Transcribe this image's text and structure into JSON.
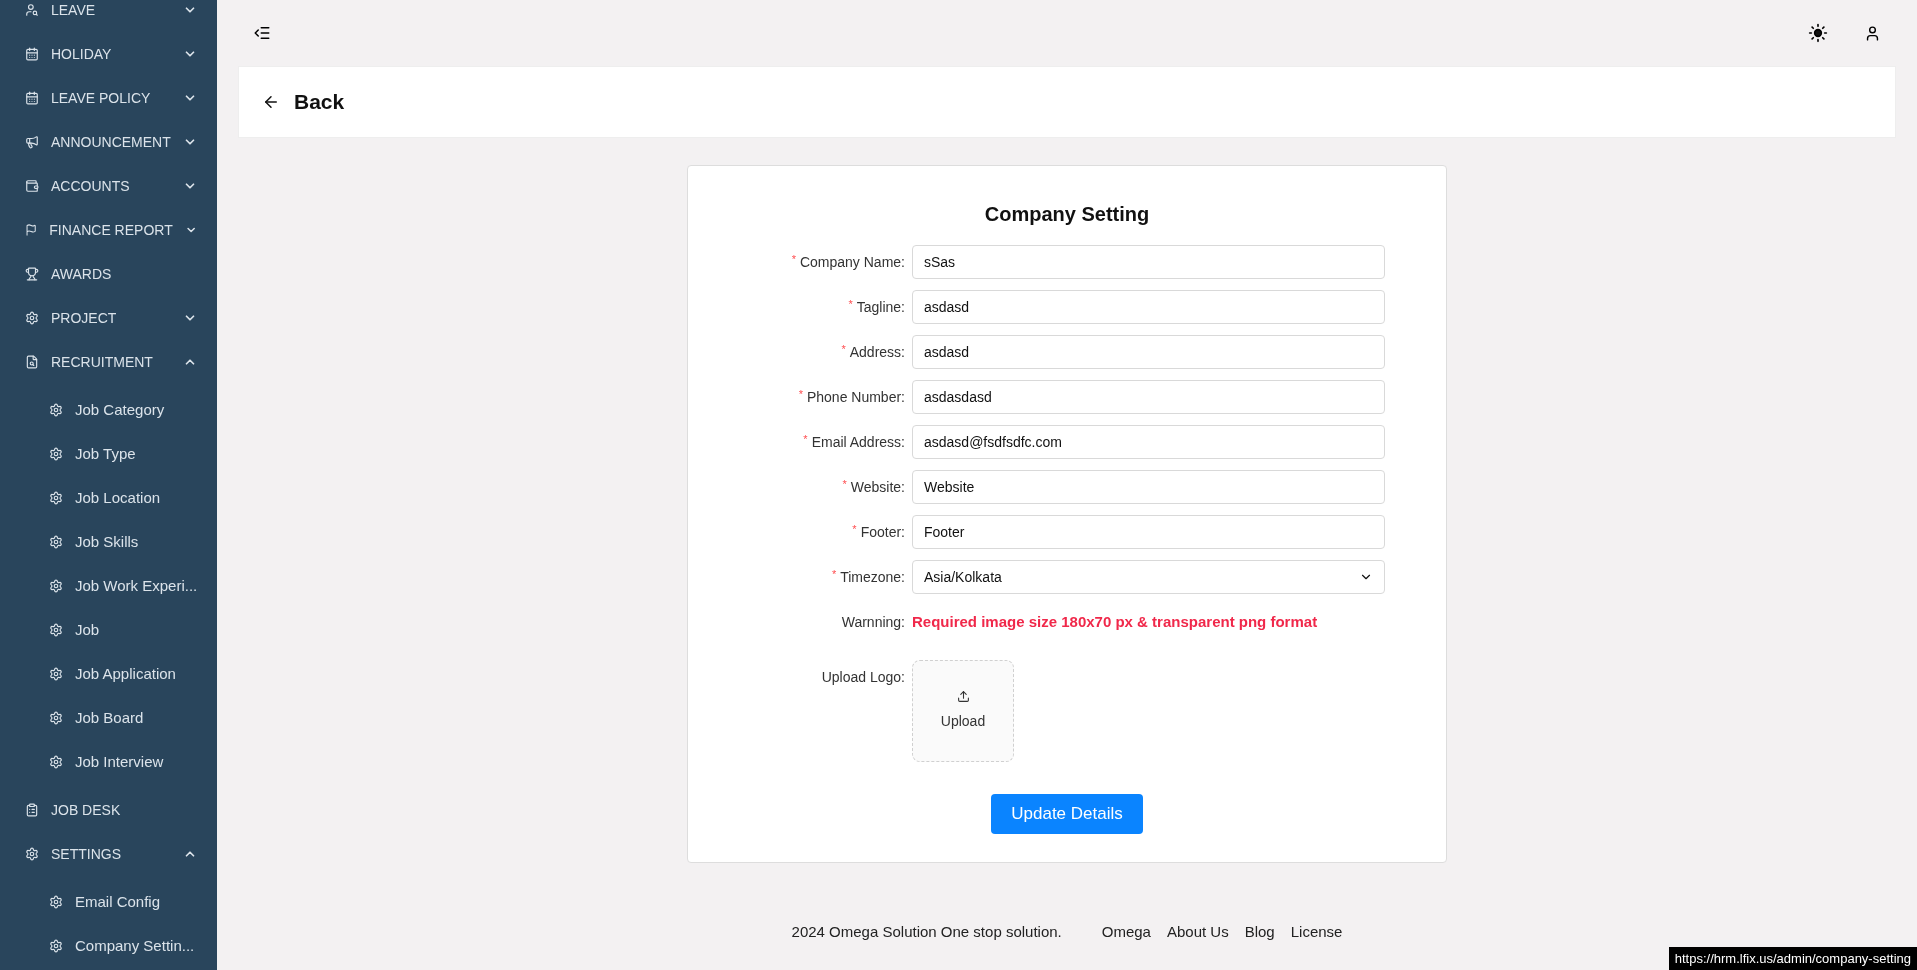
{
  "sidebar": {
    "items": [
      {
        "kind": "group",
        "label": "LEAVE",
        "expanded": false
      },
      {
        "kind": "group",
        "label": "HOLIDAY",
        "expanded": false
      },
      {
        "kind": "group",
        "label": "LEAVE POLICY",
        "expanded": false
      },
      {
        "kind": "group",
        "label": "ANNOUNCEMENT",
        "expanded": false
      },
      {
        "kind": "group",
        "label": "ACCOUNTS",
        "expanded": false
      },
      {
        "kind": "group",
        "label": "FINANCE REPORT",
        "expanded": false
      },
      {
        "kind": "link",
        "label": "AWARDS"
      },
      {
        "kind": "group",
        "label": "PROJECT",
        "expanded": false
      },
      {
        "kind": "group",
        "label": "RECRUITMENT",
        "expanded": true,
        "children": [
          {
            "label": "Job Category"
          },
          {
            "label": "Job Type"
          },
          {
            "label": "Job Location"
          },
          {
            "label": "Job Skills"
          },
          {
            "label": "Job Work Experi..."
          },
          {
            "label": "Job"
          },
          {
            "label": "Job Application"
          },
          {
            "label": "Job Board"
          },
          {
            "label": "Job Interview"
          }
        ]
      },
      {
        "kind": "link",
        "label": "JOB DESK"
      },
      {
        "kind": "group",
        "label": "SETTINGS",
        "expanded": true,
        "children": [
          {
            "label": "Email Config"
          },
          {
            "label": "Company Settin..."
          }
        ]
      }
    ]
  },
  "back": {
    "label": "Back"
  },
  "form": {
    "title": "Company Setting",
    "fields": [
      {
        "kind": "text",
        "required_mark": "*",
        "label": "Company Name:",
        "value": "sSas"
      },
      {
        "kind": "text",
        "required_mark": "*",
        "label": "Tagline:",
        "value": "asdasd"
      },
      {
        "kind": "text",
        "required_mark": "*",
        "label": "Address:",
        "value": "asdasd"
      },
      {
        "kind": "text",
        "required_mark": "*",
        "label": "Phone Number:",
        "value": "asdasdasd"
      },
      {
        "kind": "text",
        "required_mark": "*",
        "label": "Email Address:",
        "value": "asdasd@fsdfsdfc.com"
      },
      {
        "kind": "text",
        "required_mark": "*",
        "label": "Website:",
        "value": "Website"
      },
      {
        "kind": "text",
        "required_mark": "*",
        "label": "Footer:",
        "value": "Footer"
      },
      {
        "kind": "select",
        "required_mark": "*",
        "label": "Timezone:",
        "value": "Asia/Kolkata"
      },
      {
        "kind": "warning",
        "label": "Warnning:",
        "value": "Required image size 180x70 px & transparent png format"
      },
      {
        "kind": "upload",
        "label": "Upload Logo:",
        "value": "Upload"
      }
    ],
    "submit": "Update Details"
  },
  "footer": {
    "text": "2024 Omega Solution One stop solution.",
    "links": [
      "Omega",
      "About Us",
      "Blog",
      "License"
    ]
  },
  "status_bar": {
    "url": "https://hrm.lfix.us/admin/company-setting"
  }
}
